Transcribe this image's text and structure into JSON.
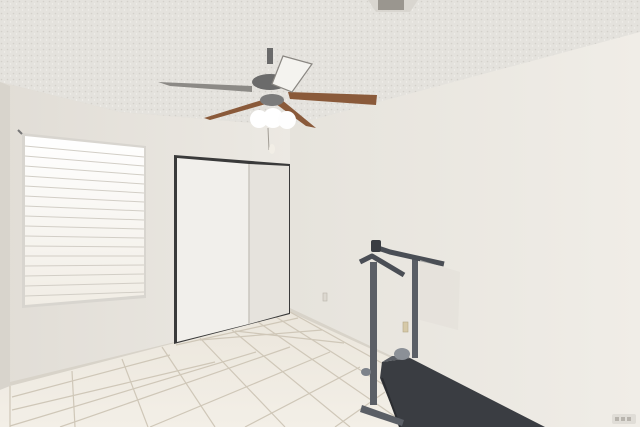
{
  "scene": {
    "room_type": "empty bedroom",
    "objects": [
      "textured-ceiling",
      "ceiling-fan",
      "window-blinds",
      "sliding-closet-doors",
      "tile-floor",
      "treadmill",
      "wall-outlet",
      "air-vent"
    ],
    "colors": {
      "ceiling": "#e4e2dd",
      "wall_left": "#ece9e3",
      "wall_right": "#e9e6df",
      "floor_tile": "#eee9df",
      "grout": "#cfc7b8",
      "fan_blade": "#8a5a3a",
      "treadmill_frame": "#5b5f66",
      "treadmill_belt": "#3a3d42",
      "closet_door": "#f1efeb",
      "blinds": "#f6f6f4"
    }
  }
}
